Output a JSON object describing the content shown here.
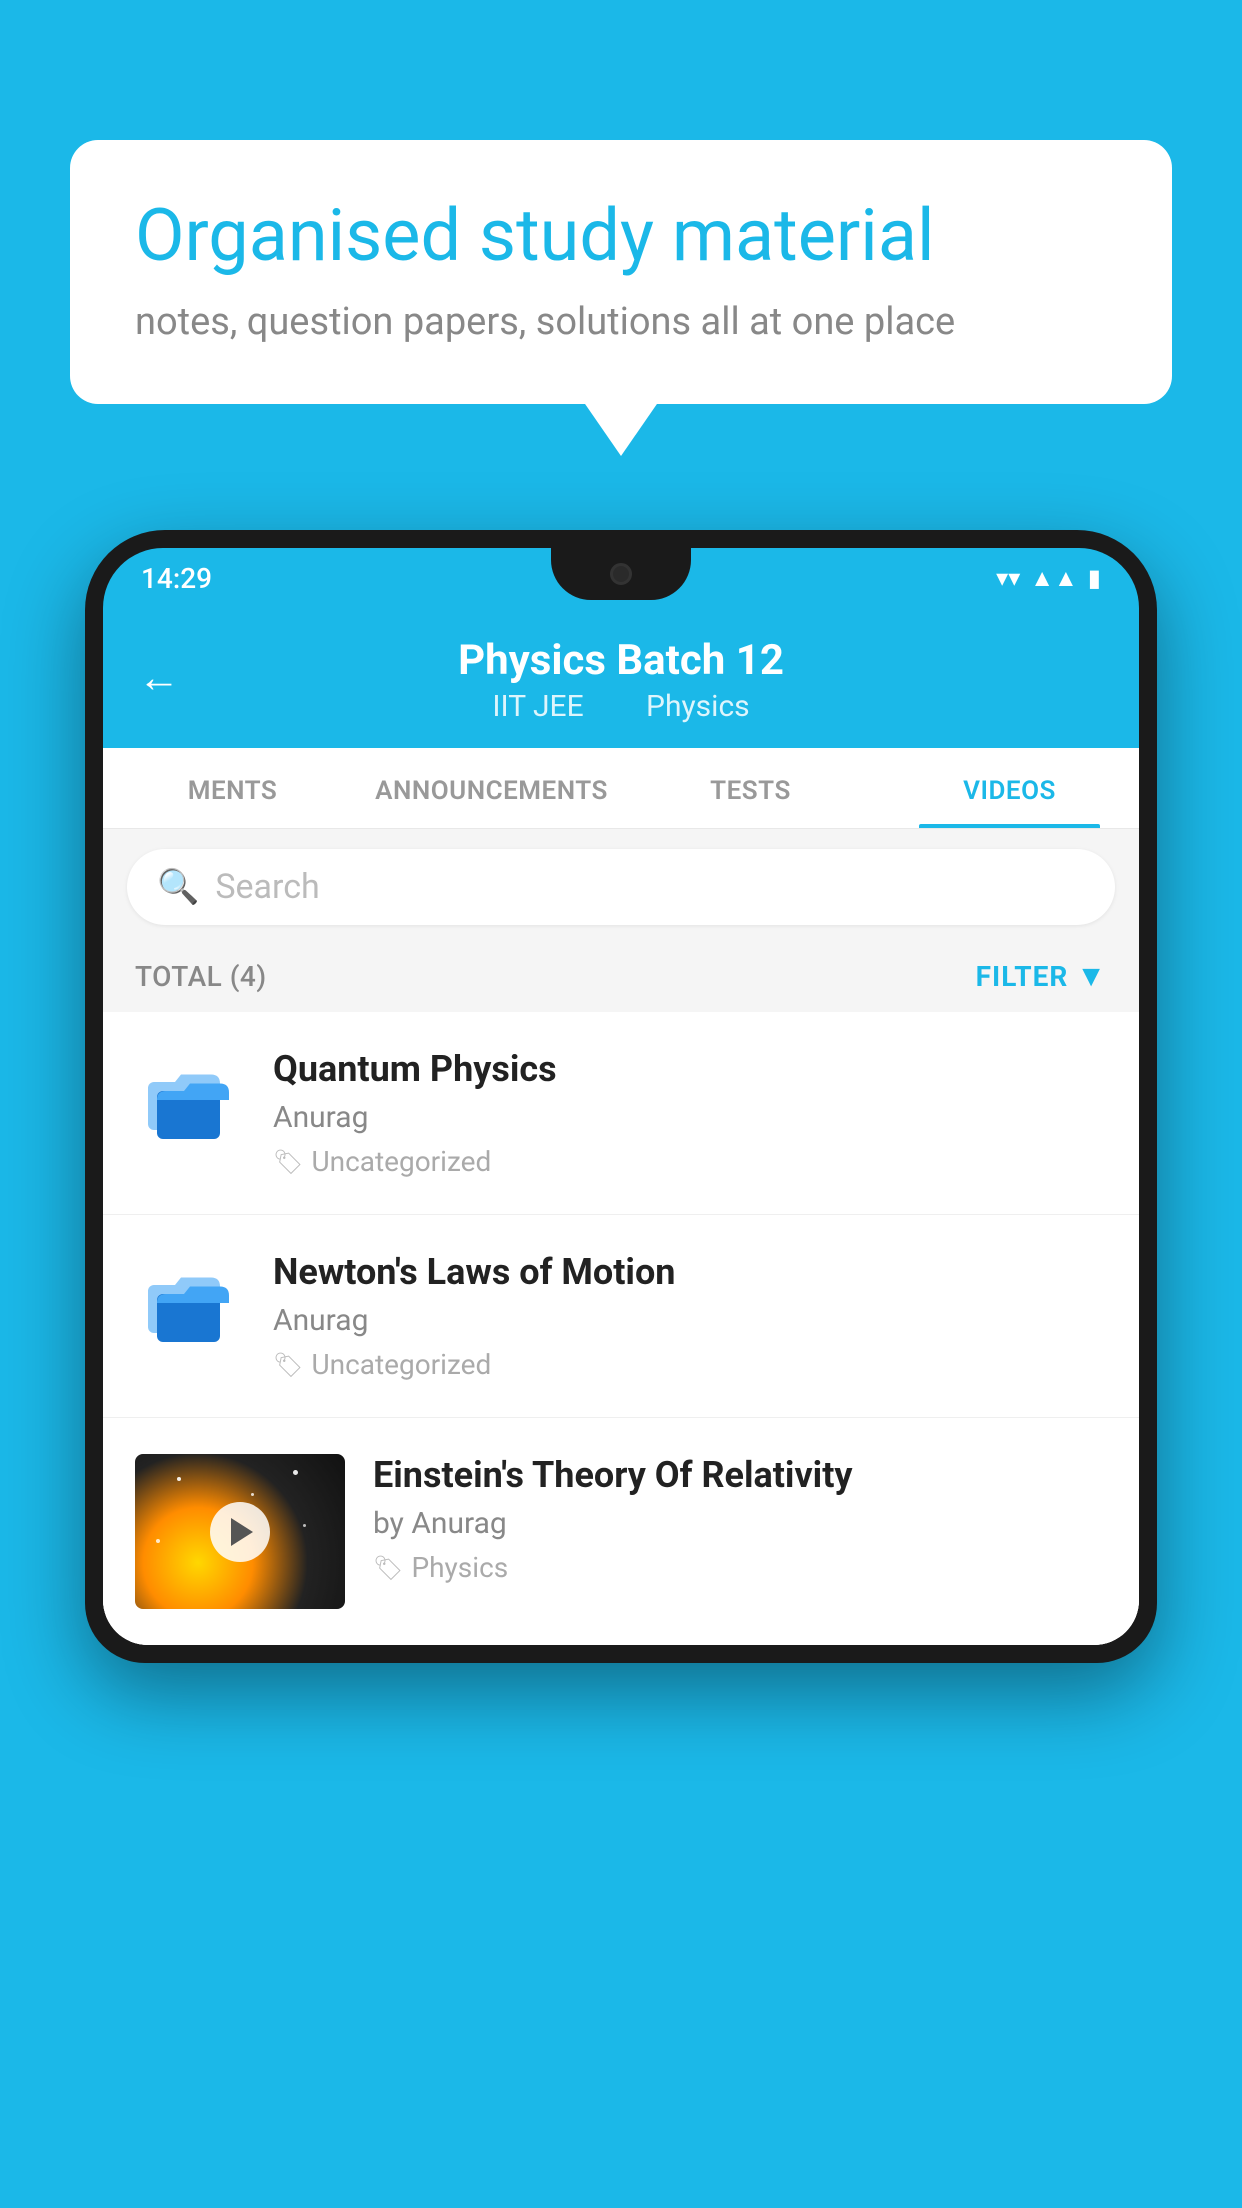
{
  "background_color": "#1BB8E8",
  "bubble": {
    "title": "Organised study material",
    "subtitle": "notes, question papers, solutions all at one place"
  },
  "phone": {
    "status": {
      "time": "14:29"
    },
    "header": {
      "title": "Physics Batch 12",
      "subtitle_tag1": "IIT JEE",
      "subtitle_tag2": "Physics",
      "back_label": "←"
    },
    "tabs": [
      {
        "label": "MENTS",
        "active": false
      },
      {
        "label": "ANNOUNCEMENTS",
        "active": false
      },
      {
        "label": "TESTS",
        "active": false
      },
      {
        "label": "VIDEOS",
        "active": true
      }
    ],
    "search": {
      "placeholder": "Search"
    },
    "filter": {
      "total_label": "TOTAL (4)",
      "filter_label": "FILTER"
    },
    "videos": [
      {
        "title": "Quantum Physics",
        "author": "Anurag",
        "tag": "Uncategorized",
        "has_thumb": false
      },
      {
        "title": "Newton's Laws of Motion",
        "author": "Anurag",
        "tag": "Uncategorized",
        "has_thumb": false
      },
      {
        "title": "Einstein's Theory Of Relativity",
        "author": "by Anurag",
        "tag": "Physics",
        "has_thumb": true
      }
    ]
  }
}
